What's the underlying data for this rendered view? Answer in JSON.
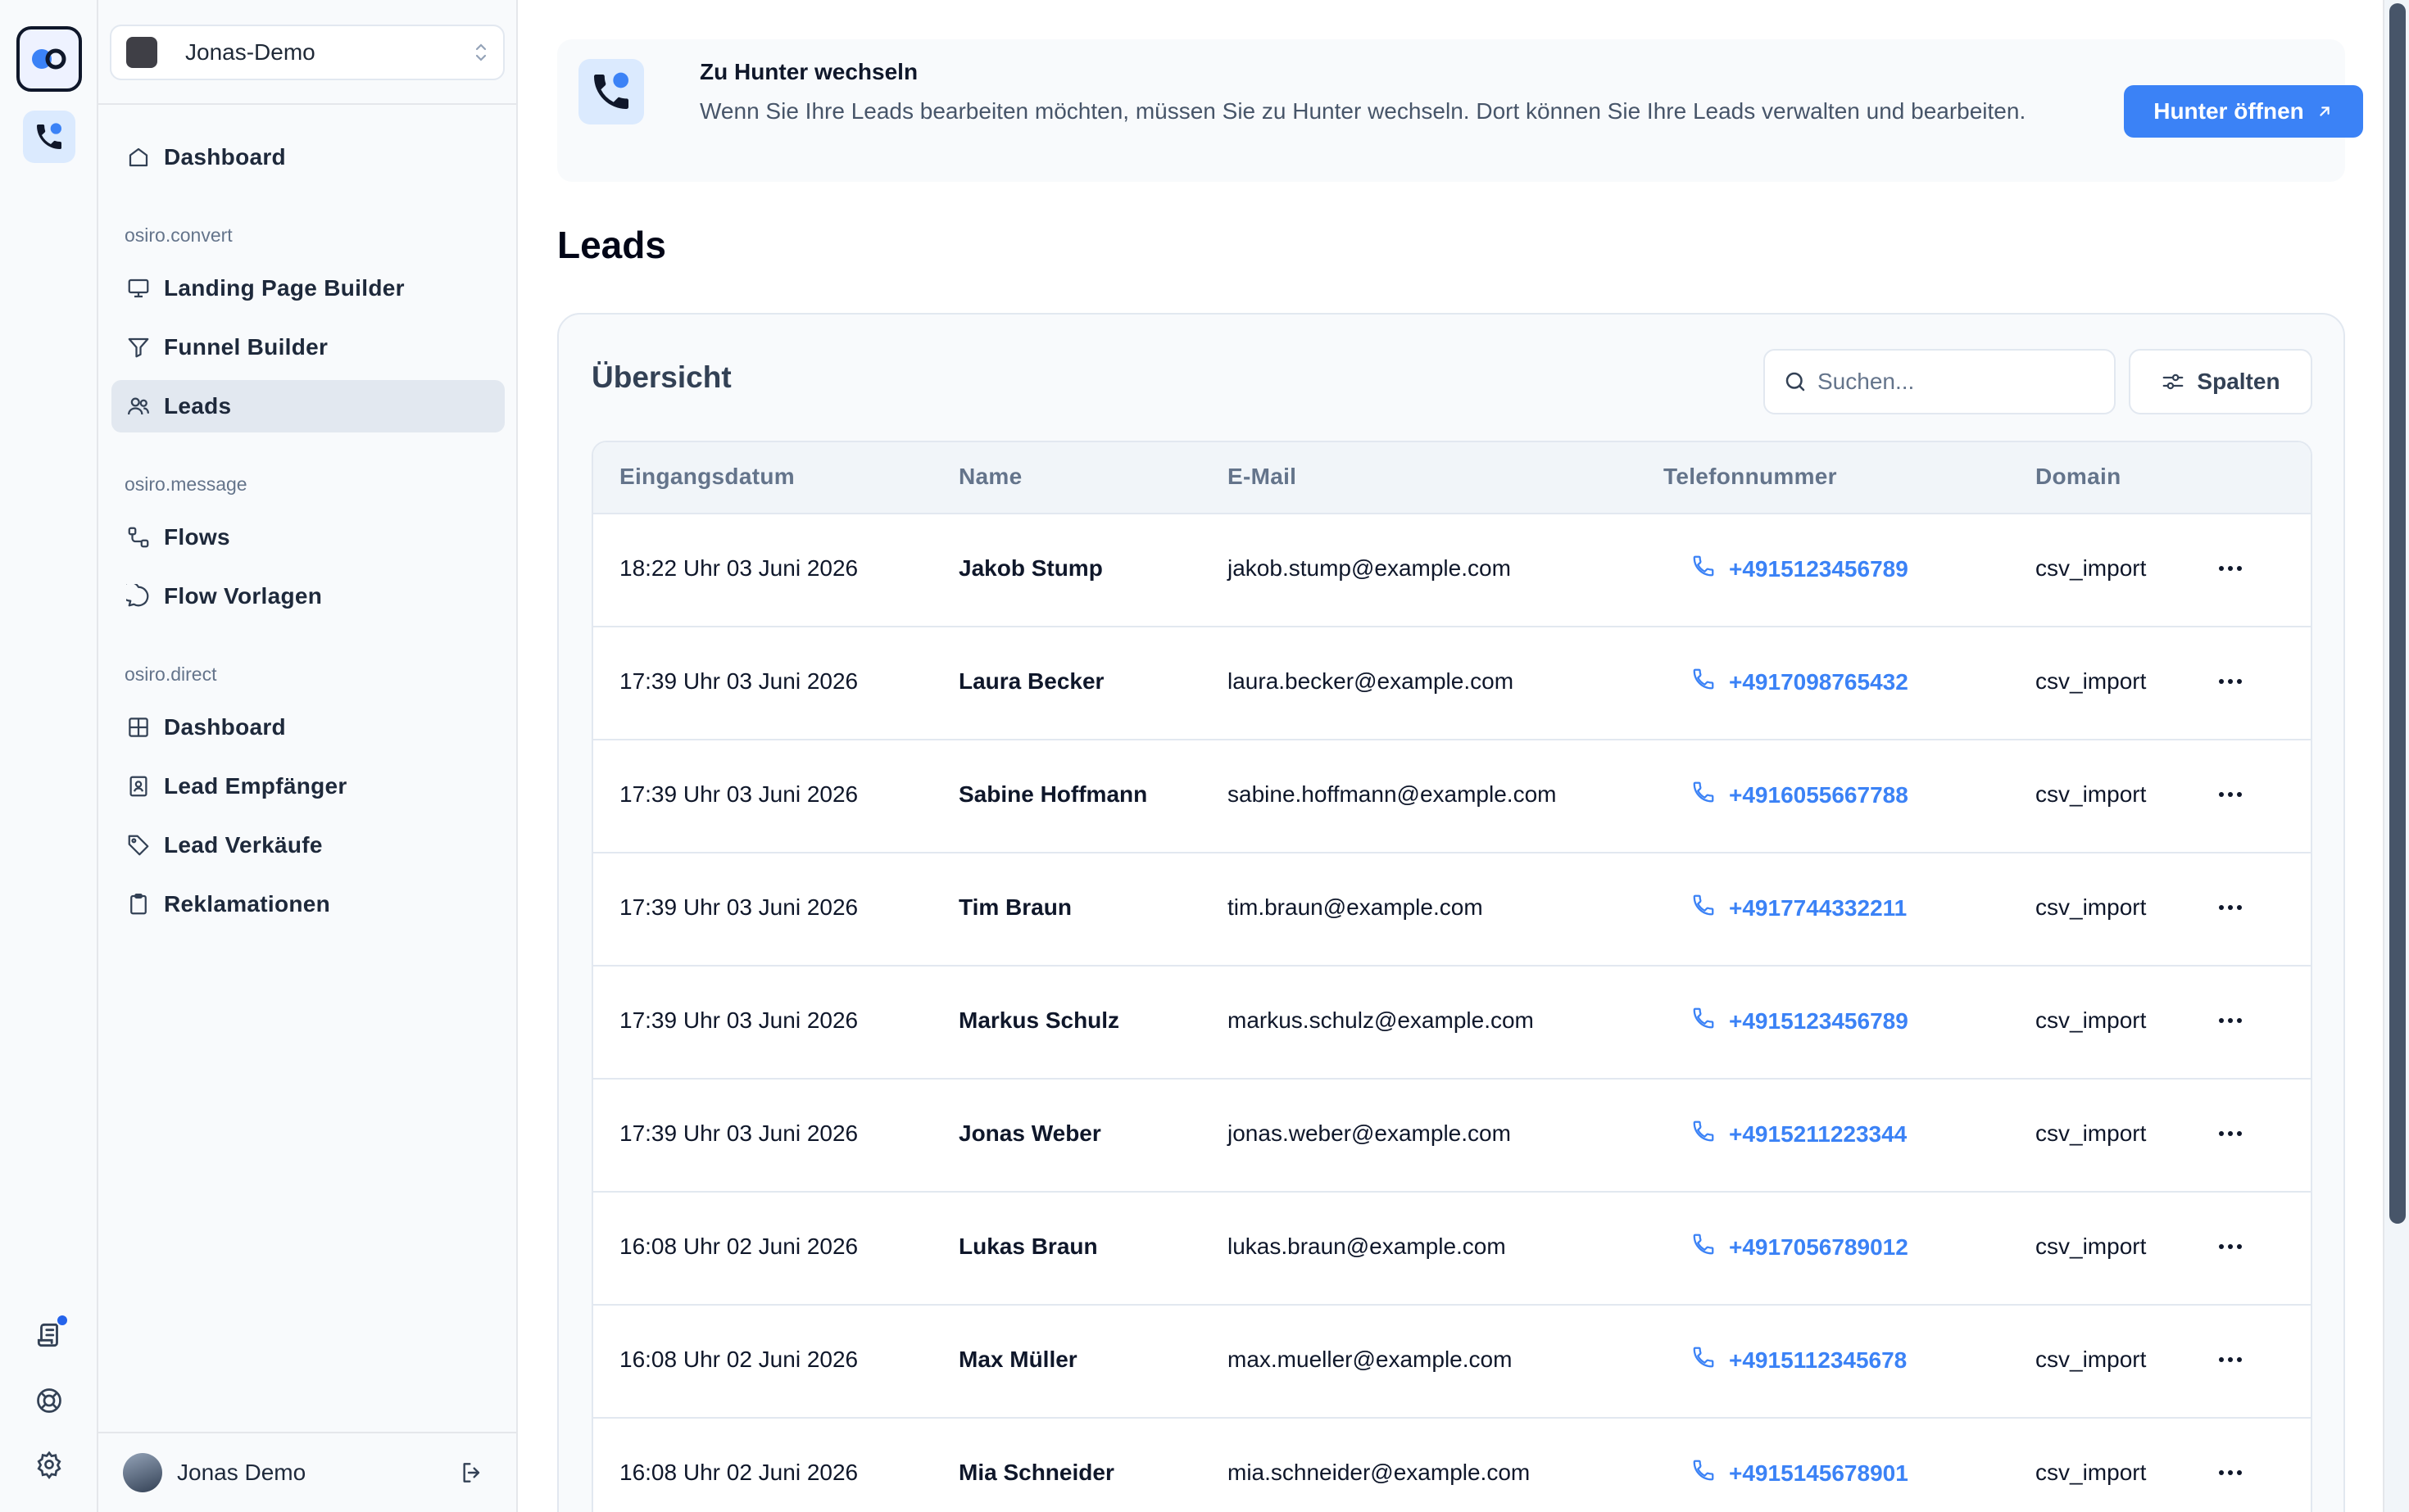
{
  "workspace": {
    "name": "Jonas-Demo"
  },
  "sidebar": {
    "top_items": [
      {
        "label": "Dashboard",
        "icon": "home-icon"
      }
    ],
    "sections": [
      {
        "label": "osiro.convert",
        "items": [
          {
            "label": "Landing Page Builder",
            "icon": "monitor-icon"
          },
          {
            "label": "Funnel Builder",
            "icon": "filter-icon"
          },
          {
            "label": "Leads",
            "icon": "users-icon",
            "active": true
          }
        ]
      },
      {
        "label": "osiro.message",
        "items": [
          {
            "label": "Flows",
            "icon": "flow-icon"
          },
          {
            "label": "Flow Vorlagen",
            "icon": "chat-bubble-icon"
          }
        ]
      },
      {
        "label": "osiro.direct",
        "items": [
          {
            "label": "Dashboard",
            "icon": "grid-icon"
          },
          {
            "label": "Lead Empfänger",
            "icon": "contact-card-icon"
          },
          {
            "label": "Lead Verkäufe",
            "icon": "tag-icon"
          },
          {
            "label": "Reklamationen",
            "icon": "clipboard-icon"
          }
        ]
      }
    ],
    "user": {
      "name": "Jonas Demo"
    }
  },
  "banner": {
    "title": "Zu Hunter wechseln",
    "text": "Wenn Sie Ihre Leads bearbeiten möchten, müssen Sie zu Hunter wechseln. Dort können Sie Ihre Leads verwalten und bearbeiten.",
    "button_label": "Hunter öffnen"
  },
  "page": {
    "title": "Leads"
  },
  "overview": {
    "title": "Übersicht",
    "search_placeholder": "Suchen...",
    "columns_button": "Spalten"
  },
  "table": {
    "headers": [
      "Eingangsdatum",
      "Name",
      "E-Mail",
      "Telefonnummer",
      "Domain"
    ],
    "rows": [
      {
        "date": "18:22 Uhr 03 Juni 2026",
        "name": "Jakob Stump",
        "email": "jakob.stump@example.com",
        "phone": "+4915123456789",
        "domain": "csv_import"
      },
      {
        "date": "17:39 Uhr 03 Juni 2026",
        "name": "Laura Becker",
        "email": "laura.becker@example.com",
        "phone": "+4917098765432",
        "domain": "csv_import"
      },
      {
        "date": "17:39 Uhr 03 Juni 2026",
        "name": "Sabine Hoffmann",
        "email": "sabine.hoffmann@example.com",
        "phone": "+4916055667788",
        "domain": "csv_import"
      },
      {
        "date": "17:39 Uhr 03 Juni 2026",
        "name": "Tim Braun",
        "email": "tim.braun@example.com",
        "phone": "+4917744332211",
        "domain": "csv_import"
      },
      {
        "date": "17:39 Uhr 03 Juni 2026",
        "name": "Markus Schulz",
        "email": "markus.schulz@example.com",
        "phone": "+4915123456789",
        "domain": "csv_import"
      },
      {
        "date": "17:39 Uhr 03 Juni 2026",
        "name": "Jonas Weber",
        "email": "jonas.weber@example.com",
        "phone": "+4915211223344",
        "domain": "csv_import"
      },
      {
        "date": "16:08 Uhr 02 Juni 2026",
        "name": "Lukas Braun",
        "email": "lukas.braun@example.com",
        "phone": "+4917056789012",
        "domain": "csv_import"
      },
      {
        "date": "16:08 Uhr 02 Juni 2026",
        "name": "Max Müller",
        "email": "max.mueller@example.com",
        "phone": "+4915112345678",
        "domain": "csv_import"
      },
      {
        "date": "16:08 Uhr 02 Juni 2026",
        "name": "Mia Schneider",
        "email": "mia.schneider@example.com",
        "phone": "+4915145678901",
        "domain": "csv_import"
      }
    ]
  },
  "colors": {
    "accent": "#3b82f6",
    "sidebar_bg": "#f8fafc",
    "active_bg": "#e2e8f0"
  }
}
